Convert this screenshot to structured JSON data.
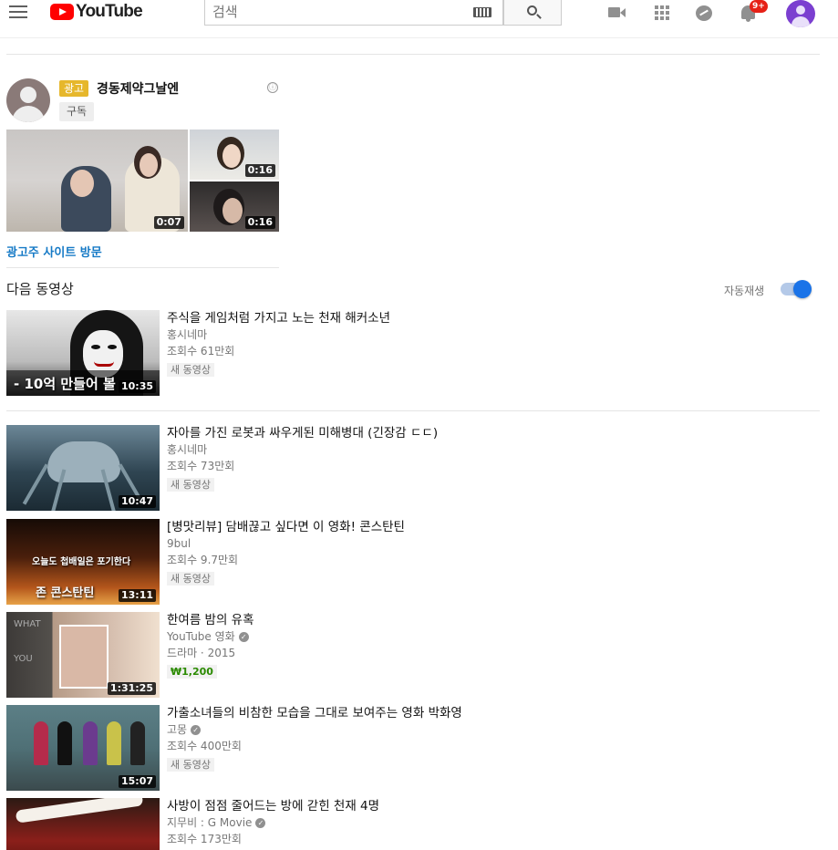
{
  "header": {
    "logo_text": "YouTube",
    "search_placeholder": "검색",
    "notification_count": "9+",
    "icons": [
      "menu-icon",
      "youtube-logo",
      "keyboard-icon",
      "search-icon",
      "video-camera-icon",
      "apps-grid-icon",
      "messages-icon",
      "notifications-bell-icon",
      "account-avatar"
    ]
  },
  "ad": {
    "tag": "광고",
    "title": "경동제약그날엔",
    "subscribe_label": "구독",
    "info_icon": "ⓘ",
    "clips": [
      {
        "duration": "0:07"
      },
      {
        "duration": "0:16"
      },
      {
        "duration": "0:16"
      }
    ],
    "visit_label": "광고주 사이트 방문"
  },
  "up_next": {
    "label": "다음 동영상",
    "autoplay_label": "자동재생",
    "autoplay_on": true,
    "toggle_color": "#1a73e8"
  },
  "videos": [
    {
      "title": "주식을 게임처럼 가지고 노는 천재 해커소년",
      "channel": "홍시네마",
      "verified": false,
      "line2": "조회수 61만회",
      "badge": "새 동영상",
      "duration": "10:35",
      "overlay": "- 10억 만들어 볼"
    },
    {
      "title": "자아를 가진 로봇과 싸우게된 미해병대 (긴장감 ㄷㄷ)",
      "channel": "홍시네마",
      "verified": false,
      "line2": "조회수 73만회",
      "badge": "새 동영상",
      "duration": "10:47",
      "overlay": ""
    },
    {
      "title": "[병맛리뷰] 담배끊고 싶다면 이 영화! 콘스탄틴",
      "channel": "9bul",
      "verified": false,
      "line2": "조회수 9.7만회",
      "badge": "새 동영상",
      "duration": "13:11",
      "overlay": "오늘도 첩배일은 포기한다",
      "overlay2": "존 콘스탄틴"
    },
    {
      "title": "한여름 밤의 유혹",
      "channel": "YouTube 영화",
      "verified": true,
      "line2": "드라마 · 2015",
      "badge": "₩1,200",
      "duration": "1:31:25",
      "overlay": "WHAT",
      "overlay2": "YOU"
    },
    {
      "title": "가출소녀들의 비참한 모습을 그대로 보여주는 영화 박화영",
      "channel": "고몽",
      "verified": true,
      "line2": "조회수 400만회",
      "badge": "새 동영상",
      "duration": "15:07",
      "overlay": ""
    },
    {
      "title": "사방이 점점 줄어드는 방에 갇힌 천재 4명",
      "channel": "지무비 : G Movie",
      "verified": true,
      "line2": "조회수 173만회",
      "badge": "",
      "duration": "",
      "overlay": ""
    }
  ],
  "colors": {
    "brand_red": "#ff0000",
    "ad_tag": "#e6b72c",
    "link_blue": "#167ac6",
    "price_green": "#2a8a00"
  }
}
